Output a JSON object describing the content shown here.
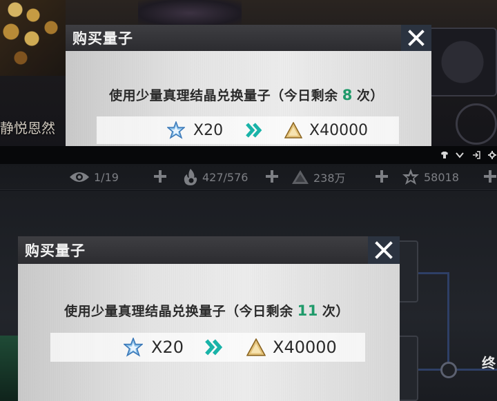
{
  "top_panel": {
    "side_text": "静悦恩然",
    "dialog": {
      "title": "购买量子",
      "description_prefix": "使用少量真理结晶兑换量子（今日剩余",
      "remaining_count": "8",
      "description_suffix": "次）",
      "give_label": "X20",
      "get_label": "X40000"
    }
  },
  "mini_toolbar": {
    "icons": [
      "shirt-icon",
      "chevron-down-icon",
      "exit-icon",
      "settings-icon"
    ]
  },
  "status_bar": {
    "vision": "1/19",
    "stamina": "427/576",
    "quantum": "238万",
    "crystal": "58018"
  },
  "bottom_panel": {
    "right_text": "终",
    "dialog": {
      "title": "购买量子",
      "description_prefix": "使用少量真理结晶兑换量子（今日剩余",
      "remaining_count": "11",
      "description_suffix": "次）",
      "give_label": "X20",
      "get_label": "X40000"
    }
  },
  "colors": {
    "count_green": "#1f9a6a",
    "arrow_teal": "#19b3a8",
    "close_bg": "#2b3340"
  }
}
